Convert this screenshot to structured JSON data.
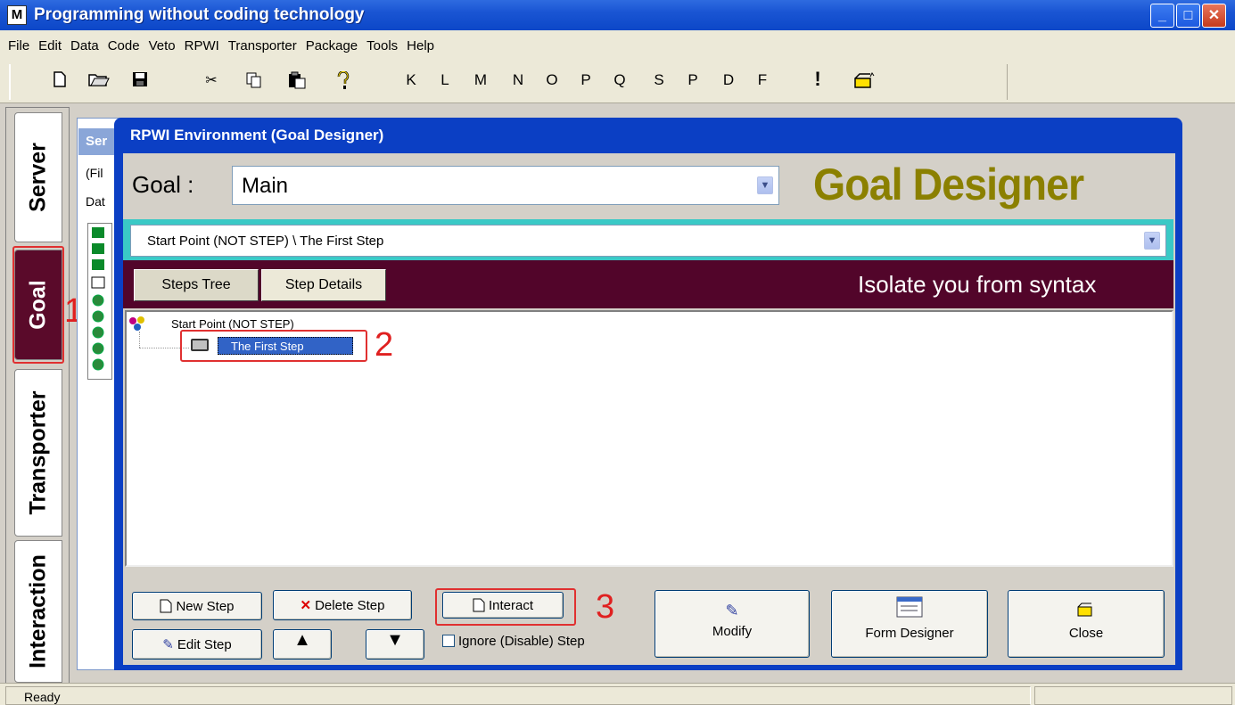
{
  "window": {
    "app_icon": "M",
    "title": "Programming without coding technology",
    "minimize": "_",
    "maximize": "□",
    "close": "✕"
  },
  "menu": [
    "File",
    "Edit",
    "Data",
    "Code",
    "Veto",
    "RPWI",
    "Transporter",
    "Package",
    "Tools",
    "Help"
  ],
  "toolbar": {
    "icons": [
      "new-file",
      "open-folder",
      "save",
      "cut",
      "copy",
      "paste",
      "help"
    ],
    "letters": [
      "K",
      "L",
      "M",
      "N",
      "O",
      "P",
      "Q",
      "S",
      "P",
      "D",
      "F"
    ],
    "exclaim": "!",
    "open_icon": "open-box"
  },
  "side_tabs": {
    "server": "Server",
    "goal": "Goal",
    "transporter": "Transporter",
    "interaction": "Interaction"
  },
  "annotations": {
    "one": "1",
    "two": "2",
    "three": "3"
  },
  "back_window": {
    "title": "Ser",
    "line1": "(Fil",
    "line2": "Dat"
  },
  "dialog": {
    "title": "RPWI Environment (Goal Designer)",
    "goal_label": "Goal :",
    "goal_value": "Main",
    "banner": "Goal Designer",
    "path": "Start Point (NOT STEP) \\ The First Step",
    "tabs": {
      "steps_tree": "Steps Tree",
      "step_details": "Step Details"
    },
    "slogan": "Isolate you from syntax",
    "tree": {
      "root": "Start Point (NOT STEP)",
      "child": "The First Step"
    },
    "buttons": {
      "new_step": "New Step",
      "delete_step": "Delete Step",
      "interact": "Interact",
      "edit_step": "Edit Step",
      "move_up": "▲",
      "move_down": "▼",
      "modify": "Modify",
      "form_designer": "Form Designer",
      "close": "Close"
    },
    "ignore_step": "Ignore (Disable) Step"
  },
  "status": {
    "text": "Ready"
  },
  "colors": {
    "title_blue": "#1a55d3",
    "maroon": "#52052a",
    "cyan": "#3ac9c6",
    "banner_olive": "#8b8000",
    "annotation_red": "#e02020"
  }
}
